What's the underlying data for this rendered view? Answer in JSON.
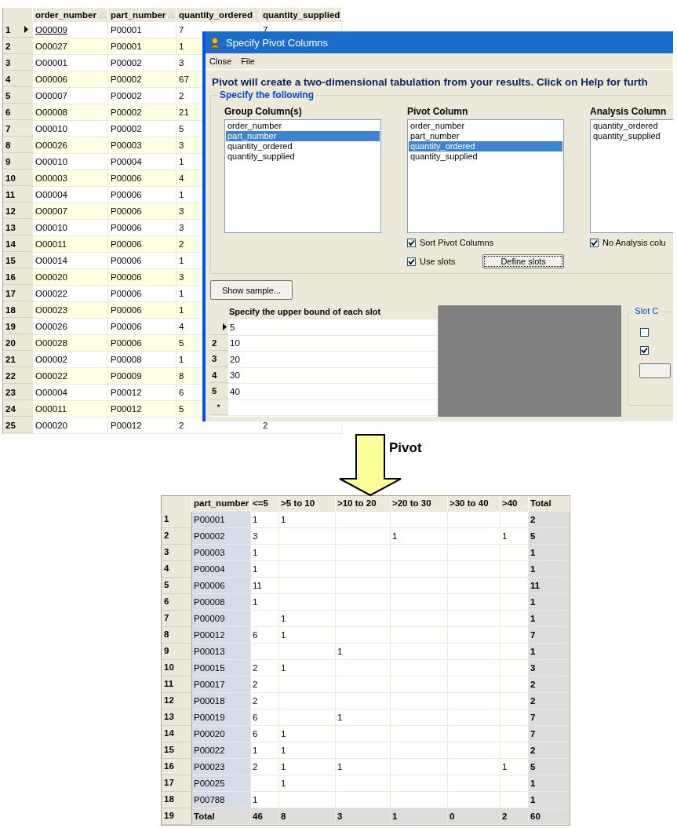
{
  "source_table": {
    "columns": [
      {
        "label": "order_number",
        "sorted": true
      },
      {
        "label": "part_number",
        "sorted": true
      },
      {
        "label": "quantity_ordered",
        "sorted": false
      },
      {
        "label": "quantity_supplied",
        "sorted": false
      }
    ],
    "rows": [
      {
        "num": "1",
        "current": true,
        "cells": [
          "O00009",
          "P00001",
          "7",
          "7"
        ]
      },
      {
        "num": "2",
        "current": false,
        "cells": [
          "O00027",
          "P00001",
          "1",
          null
        ]
      },
      {
        "num": "3",
        "current": false,
        "cells": [
          "O00001",
          "P00002",
          "3",
          null
        ]
      },
      {
        "num": "4",
        "current": false,
        "cells": [
          "O00006",
          "P00002",
          "67",
          null
        ]
      },
      {
        "num": "5",
        "current": false,
        "cells": [
          "O00007",
          "P00002",
          "2",
          null
        ]
      },
      {
        "num": "6",
        "current": false,
        "cells": [
          "O00008",
          "P00002",
          "21",
          null
        ]
      },
      {
        "num": "7",
        "current": false,
        "cells": [
          "O00010",
          "P00002",
          "5",
          null
        ]
      },
      {
        "num": "8",
        "current": false,
        "cells": [
          "O00026",
          "P00003",
          "3",
          null
        ]
      },
      {
        "num": "9",
        "current": false,
        "cells": [
          "O00010",
          "P00004",
          "1",
          null
        ]
      },
      {
        "num": "10",
        "current": false,
        "cells": [
          "O00003",
          "P00006",
          "4",
          null
        ]
      },
      {
        "num": "11",
        "current": false,
        "cells": [
          "O00004",
          "P00006",
          "1",
          null
        ]
      },
      {
        "num": "12",
        "current": false,
        "cells": [
          "O00007",
          "P00006",
          "3",
          null
        ]
      },
      {
        "num": "13",
        "current": false,
        "cells": [
          "O00010",
          "P00006",
          "3",
          null
        ]
      },
      {
        "num": "14",
        "current": false,
        "cells": [
          "O00011",
          "P00006",
          "2",
          null
        ]
      },
      {
        "num": "15",
        "current": false,
        "cells": [
          "O00014",
          "P00006",
          "1",
          null
        ]
      },
      {
        "num": "16",
        "current": false,
        "cells": [
          "O00020",
          "P00006",
          "3",
          null
        ]
      },
      {
        "num": "17",
        "current": false,
        "cells": [
          "O00022",
          "P00006",
          "1",
          null
        ]
      },
      {
        "num": "18",
        "current": false,
        "cells": [
          "O00023",
          "P00006",
          "1",
          null
        ]
      },
      {
        "num": "19",
        "current": false,
        "cells": [
          "O00026",
          "P00006",
          "4",
          null
        ]
      },
      {
        "num": "20",
        "current": false,
        "cells": [
          "O00028",
          "P00006",
          "5",
          null
        ]
      },
      {
        "num": "21",
        "current": false,
        "cells": [
          "O00002",
          "P00008",
          "1",
          null
        ]
      },
      {
        "num": "22",
        "current": false,
        "cells": [
          "O00022",
          "P00009",
          "8",
          null
        ]
      },
      {
        "num": "23",
        "current": false,
        "cells": [
          "O00004",
          "P00012",
          "6",
          null
        ]
      },
      {
        "num": "24",
        "current": false,
        "cells": [
          "O00011",
          "P00012",
          "5",
          null
        ]
      },
      {
        "num": "25",
        "current": false,
        "cells": [
          "O00020",
          "P00012",
          "2",
          "2"
        ]
      }
    ]
  },
  "dialog": {
    "title": "Specify Pivot Columns",
    "menu": [
      "Close",
      "File"
    ],
    "intro": "Pivot will create a two-dimensional tabulation from your results. Click on Help for furth",
    "group_title": "Specify the following",
    "lists": [
      {
        "heading": "Group Column(s)",
        "items": [
          {
            "label": "order_number",
            "selected": false
          },
          {
            "label": "part_number",
            "selected": true
          },
          {
            "label": "quantity_ordered",
            "selected": false
          },
          {
            "label": "quantity_supplied",
            "selected": false
          }
        ]
      },
      {
        "heading": "Pivot Column",
        "items": [
          {
            "label": "order_number",
            "selected": false
          },
          {
            "label": "part_number",
            "selected": false
          },
          {
            "label": "quantity_ordered",
            "selected": true
          },
          {
            "label": "quantity_supplied",
            "selected": false
          }
        ],
        "options": [
          {
            "label": "Sort Pivot Columns",
            "checked": true
          },
          {
            "label": "Use slots",
            "checked": true,
            "button": "Define slots"
          }
        ]
      },
      {
        "heading": "Analysis Column",
        "items": [
          {
            "label": "quantity_ordered",
            "selected": false
          },
          {
            "label": "quantity_supplied",
            "selected": false
          }
        ],
        "options": [
          {
            "label": "No Analysis colu",
            "checked": true
          }
        ]
      }
    ],
    "show_sample_button": "Show sample...",
    "slot_grid": {
      "header": "Specify the upper bound of each slot",
      "rows": [
        {
          "num": null,
          "current": true,
          "value": "5"
        },
        {
          "num": "2",
          "current": false,
          "value": "10"
        },
        {
          "num": "3",
          "current": false,
          "value": "20"
        },
        {
          "num": "4",
          "current": false,
          "value": "30"
        },
        {
          "num": "5",
          "current": false,
          "value": "40"
        }
      ],
      "new_row_marker": "*"
    },
    "slot_options": {
      "title": "Slot C",
      "checkboxes": [
        {
          "checked": false
        },
        {
          "checked": true
        }
      ]
    }
  },
  "arrow_label": "Pivot",
  "result_table": {
    "columns": [
      "",
      "part_number",
      "<=5",
      ">5 to 10",
      ">10 to 20",
      ">20 to 30",
      ">30 to 40",
      ">40",
      "Total"
    ],
    "rows": [
      {
        "kind": "data",
        "cells": [
          "1",
          "P00001",
          "1",
          "1",
          null,
          null,
          null,
          null,
          "2"
        ]
      },
      {
        "kind": "data",
        "cells": [
          "2",
          "P00002",
          "3",
          null,
          null,
          "1",
          null,
          "1",
          "5"
        ]
      },
      {
        "kind": "data",
        "cells": [
          "3",
          "P00003",
          "1",
          null,
          null,
          null,
          null,
          null,
          "1"
        ]
      },
      {
        "kind": "data",
        "cells": [
          "4",
          "P00004",
          "1",
          null,
          null,
          null,
          null,
          null,
          "1"
        ]
      },
      {
        "kind": "data",
        "cells": [
          "5",
          "P00006",
          "11",
          null,
          null,
          null,
          null,
          null,
          "11"
        ]
      },
      {
        "kind": "data",
        "cells": [
          "6",
          "P00008",
          "1",
          null,
          null,
          null,
          null,
          null,
          "1"
        ]
      },
      {
        "kind": "data",
        "cells": [
          "7",
          "P00009",
          null,
          "1",
          null,
          null,
          null,
          null,
          "1"
        ]
      },
      {
        "kind": "data",
        "cells": [
          "8",
          "P00012",
          "6",
          "1",
          null,
          null,
          null,
          null,
          "7"
        ]
      },
      {
        "kind": "data",
        "cells": [
          "9",
          "P00013",
          null,
          null,
          "1",
          null,
          null,
          null,
          "1"
        ]
      },
      {
        "kind": "data",
        "cells": [
          "10",
          "P00015",
          "2",
          "1",
          null,
          null,
          null,
          null,
          "3"
        ]
      },
      {
        "kind": "data",
        "cells": [
          "11",
          "P00017",
          "2",
          null,
          null,
          null,
          null,
          null,
          "2"
        ]
      },
      {
        "kind": "data",
        "cells": [
          "12",
          "P00018",
          "2",
          null,
          null,
          null,
          null,
          null,
          "2"
        ]
      },
      {
        "kind": "data",
        "cells": [
          "13",
          "P00019",
          "6",
          null,
          "1",
          null,
          null,
          null,
          "7"
        ]
      },
      {
        "kind": "data",
        "cells": [
          "14",
          "P00020",
          "6",
          "1",
          null,
          null,
          null,
          null,
          "7"
        ]
      },
      {
        "kind": "data",
        "cells": [
          "15",
          "P00022",
          "1",
          "1",
          null,
          null,
          null,
          null,
          "2"
        ]
      },
      {
        "kind": "data",
        "cells": [
          "16",
          "P00023",
          "2",
          "1",
          "1",
          null,
          null,
          "1",
          "5"
        ]
      },
      {
        "kind": "data",
        "cells": [
          "17",
          "P00025",
          null,
          "1",
          null,
          null,
          null,
          null,
          "1"
        ]
      },
      {
        "kind": "data",
        "cells": [
          "18",
          "P00788",
          "1",
          null,
          null,
          null,
          null,
          null,
          "1"
        ]
      },
      {
        "kind": "total",
        "cells": [
          "19",
          "Total",
          "46",
          "8",
          "3",
          "1",
          "0",
          "2",
          "60"
        ]
      }
    ]
  }
}
